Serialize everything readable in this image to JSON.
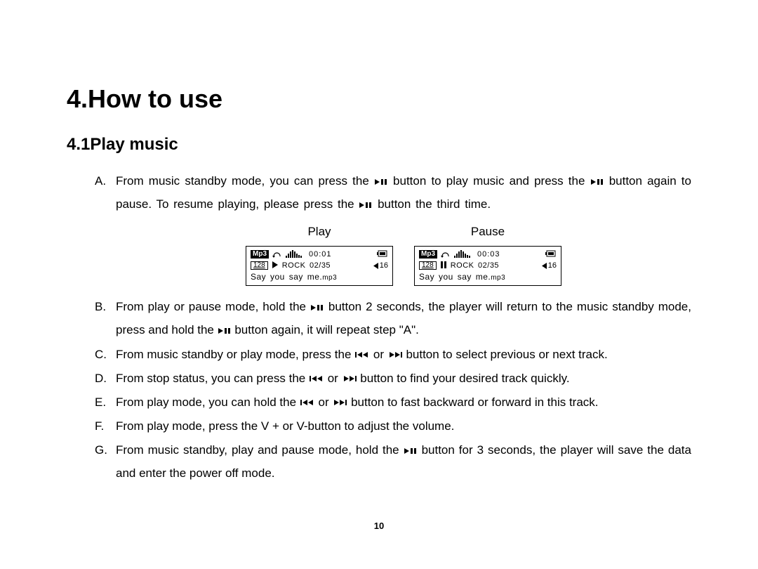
{
  "title": "4.How to use",
  "subtitle": "4.1Play music",
  "page_number": "10",
  "shots_labels": {
    "play": "Play",
    "pause": "Pause"
  },
  "lcd_play": {
    "format": "Mp3",
    "bitrate": "128",
    "time": "00:01",
    "track_meta": "ROCK 02/35",
    "vol": "16",
    "filename": "Say you say me.",
    "ext": "mp3"
  },
  "lcd_pause": {
    "format": "Mp3",
    "bitrate": "128",
    "time": "00:03",
    "track_meta": "ROCK 02/35",
    "vol": "16",
    "filename": "Say you say me.",
    "ext": "mp3"
  },
  "steps": {
    "A": {
      "letter": "A.",
      "p1": "From music standby mode, you can press the ",
      "p2": " button to play music and press the ",
      "p3": " button again to pause. To resume playing, please press the ",
      "p4": " button the third time."
    },
    "B": {
      "letter": "B.",
      "p1": "From play or pause mode,  hold the ",
      "p2": " button 2 seconds, the player will return to the music standby mode, press and hold the ",
      "p3": " button again, it will repeat step \"A\"."
    },
    "C": {
      "letter": "C.",
      "p1": "From music standby or play mode, press the ",
      "or": " or ",
      "p2": " button to select previous or next track."
    },
    "D": {
      "letter": "D.",
      "p1": "From stop status, you can press the ",
      "or": "or",
      "p2": " button to find your desired track quickly."
    },
    "E": {
      "letter": "E.",
      "p1": "From play mode, you can hold the ",
      "or": "or",
      "p2": " button to fast backward or forward in this track."
    },
    "F": {
      "letter": "F.",
      "p1": "From play mode, press the V + or V-button to adjust the volume."
    },
    "G": {
      "letter": "G.",
      "p1": "From music standby, play and pause mode, hold the ",
      "p2": " button for 3 seconds, the player will save the data and enter the power off mode."
    }
  }
}
